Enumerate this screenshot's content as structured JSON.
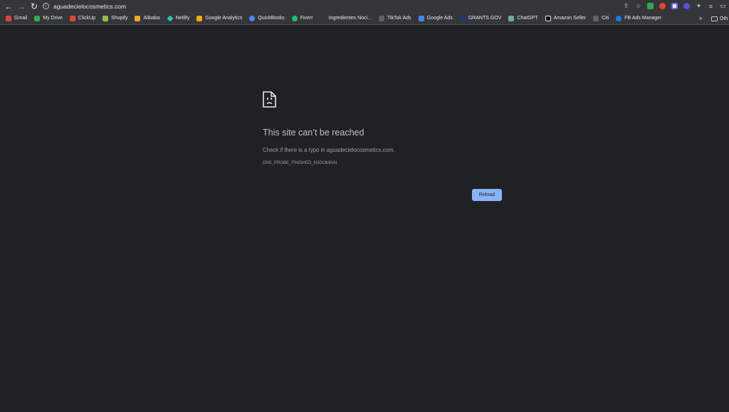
{
  "toolbar": {
    "back_icon": "arrow-left-icon",
    "forward_icon": "arrow-right-icon",
    "reload_icon": "reload-icon",
    "url": "aguadecielocosmetics.com"
  },
  "bookmarks": [
    {
      "label": "Gmail",
      "color": "#ea4335"
    },
    {
      "label": "My Drive",
      "color": "#34a853"
    },
    {
      "label": "ClickUp",
      "color": "#e44332"
    },
    {
      "label": "Shopify",
      "color": "#95bf47"
    },
    {
      "label": "Alibaba",
      "color": "#f6a623"
    },
    {
      "label": "Netlify",
      "color": "#25c7b7"
    },
    {
      "label": "Google Analytics",
      "color": "#f9ab00"
    },
    {
      "label": "QuickBooks",
      "color": "#4a8af4"
    },
    {
      "label": "Fiverr",
      "color": "#1dbf73"
    },
    {
      "label": "Ingredientes Noci...",
      "color": "#35363a"
    },
    {
      "label": "TikTok Ads",
      "color": "#5f6368"
    },
    {
      "label": "Google Ads",
      "color": "#4285f4"
    },
    {
      "label": "GRANTS.GOV",
      "color": "#1a3b73"
    },
    {
      "label": "ChatGPT",
      "color": "#74aa9c"
    },
    {
      "label": "Amazon Seller",
      "color": "#111111"
    },
    {
      "label": "Citi",
      "color": "#5f6368"
    },
    {
      "label": "FB Ads Manager",
      "color": "#1877f2"
    }
  ],
  "bookmarks_overflow": "»",
  "other_bookmarks": "Oth",
  "error": {
    "title": "This site can’t be reached",
    "message": "Check if there is a typo in aguadecielocosmetics.com.",
    "code": "DNS_PROBE_FINISHED_NXDOMAIN",
    "reload_label": "Reload"
  }
}
